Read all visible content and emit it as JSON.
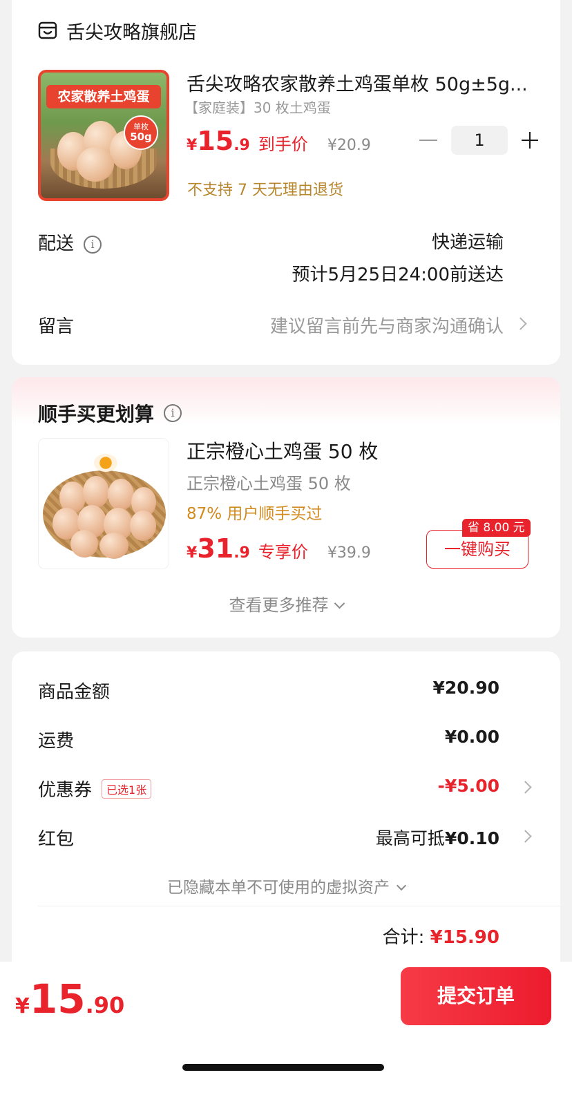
{
  "store": {
    "name": "舌尖攻略旗舰店",
    "icon": "store-icon"
  },
  "product": {
    "image_banner": "农家散养土鸡蛋",
    "image_badge_top": "单枚",
    "image_badge_value": "50g",
    "title": "舌尖攻略农家散养土鸡蛋单枚 50g±5g...",
    "spec": "【家庭装】30 枚土鸡蛋",
    "price_currency": "¥",
    "price_int": "15",
    "price_dec": ".9",
    "price_tag": "到手价",
    "original_price": "¥20.9",
    "quantity": "1",
    "return_note": "不支持 7 天无理由退货"
  },
  "delivery": {
    "label": "配送",
    "method": "快递运输",
    "eta": "预计5月25日24:00前送达"
  },
  "message": {
    "label": "留言",
    "hint": "建议留言前先与商家沟通确认"
  },
  "recommend": {
    "title": "顺手买更划算",
    "item_name": "正宗橙心土鸡蛋 50 枚",
    "item_sub": "正宗橙心土鸡蛋 50 枚",
    "item_pct": "87% 用户顺手买过",
    "price_currency": "¥",
    "price_int": "31",
    "price_dec": ".9",
    "price_tag": "专享价",
    "original_price": "¥39.9",
    "save_tag": "省 8.00 元",
    "buy_label": "一键购买",
    "more_label": "查看更多推荐"
  },
  "summary": {
    "goods_label": "商品金额",
    "goods_value": "¥20.90",
    "shipping_label": "运费",
    "shipping_value": "¥0.00",
    "coupon_label": "优惠券",
    "coupon_tag": "已选1张",
    "coupon_value": "-¥5.00",
    "redpacket_label": "红包",
    "redpacket_prefix": "最高可抵",
    "redpacket_value": "¥0.10",
    "hidden_note": "已隐藏本单不可使用的虚拟资产",
    "total_label": "合计:",
    "total_value": "¥15.90"
  },
  "footer": {
    "pay_currency": "¥",
    "pay_int": "15",
    "pay_dec": ".90",
    "submit_label": "提交订单"
  },
  "colors": {
    "accent_red": "#e8232c",
    "gold": "#b8862d",
    "muted": "#8a8a8a"
  }
}
